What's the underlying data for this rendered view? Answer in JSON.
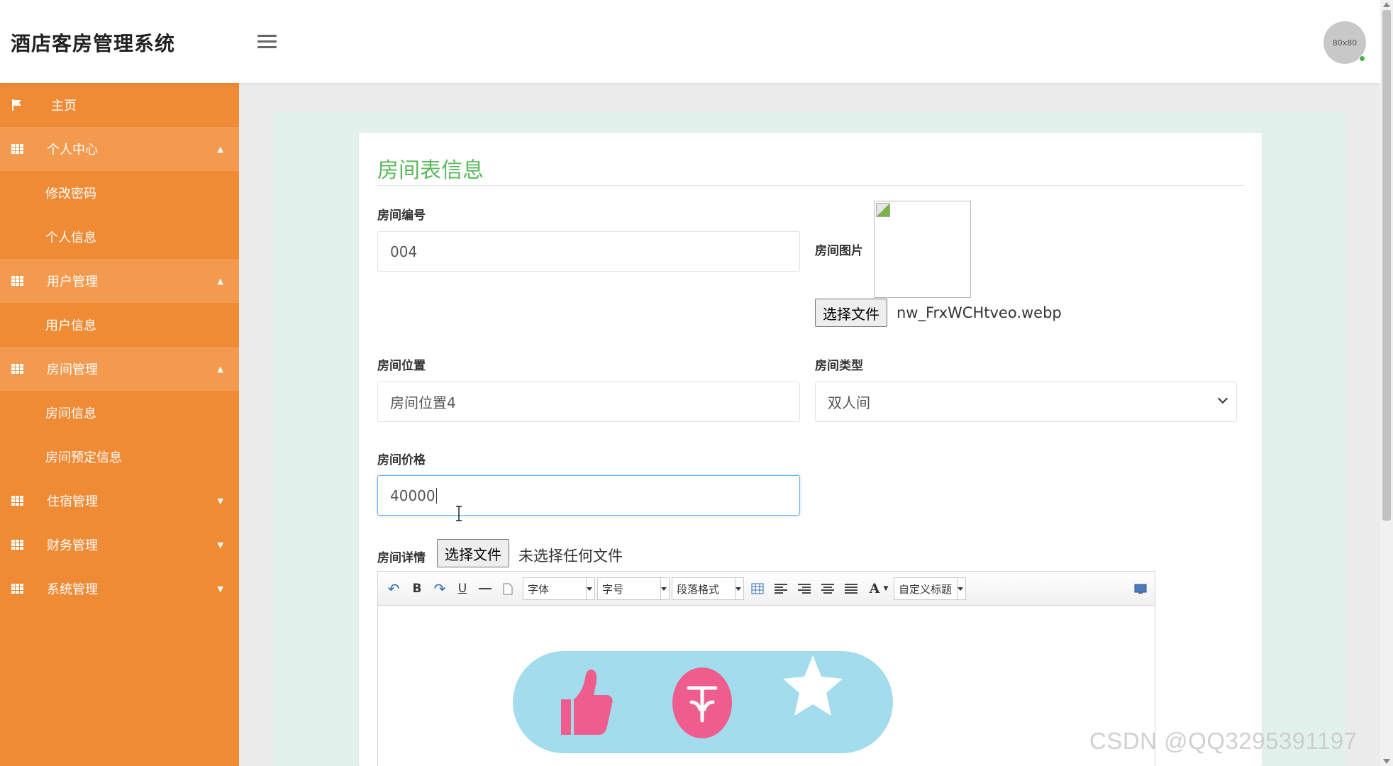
{
  "header": {
    "title": "酒店客房管理系统",
    "avatar_text": "80x80"
  },
  "sidebar": {
    "home": "主页",
    "groups": [
      {
        "label": "个人中心",
        "expanded": true,
        "items": [
          "修改密码",
          "个人信息"
        ]
      },
      {
        "label": "用户管理",
        "expanded": true,
        "items": [
          "用户信息"
        ]
      },
      {
        "label": "房间管理",
        "expanded": true,
        "items": [
          "房间信息",
          "房间预定信息"
        ]
      },
      {
        "label": "住宿管理",
        "expanded": false,
        "items": []
      },
      {
        "label": "财务管理",
        "expanded": false,
        "items": []
      },
      {
        "label": "系统管理",
        "expanded": false,
        "items": []
      }
    ]
  },
  "form": {
    "title": "房间表信息",
    "room_number": {
      "label": "房间编号",
      "value": "004"
    },
    "room_image": {
      "label": "房间图片",
      "file_button": "选择文件",
      "file_name": "nw_FrxWCHtveo.webp"
    },
    "room_location": {
      "label": "房间位置",
      "value": "房间位置4"
    },
    "room_type": {
      "label": "房间类型",
      "value": "双人间"
    },
    "room_price": {
      "label": "房间价格",
      "value": "40000"
    },
    "room_details": {
      "label": "房间详情",
      "file_button": "选择文件",
      "file_status": "未选择任何文件"
    }
  },
  "editor": {
    "toolbar": {
      "bold": "B",
      "underline": "U",
      "font_family": "字体",
      "font_size": "字号",
      "paragraph": "段落格式",
      "font_color": "A",
      "custom_title": "自定义标题"
    }
  },
  "watermark": "CSDN @QQ3295391197",
  "colors": {
    "sidebar": "#ef8a35",
    "sidebar_group": "#f39a4f",
    "title_green": "#5cb85c",
    "content_bg": "#e3f1ec"
  }
}
